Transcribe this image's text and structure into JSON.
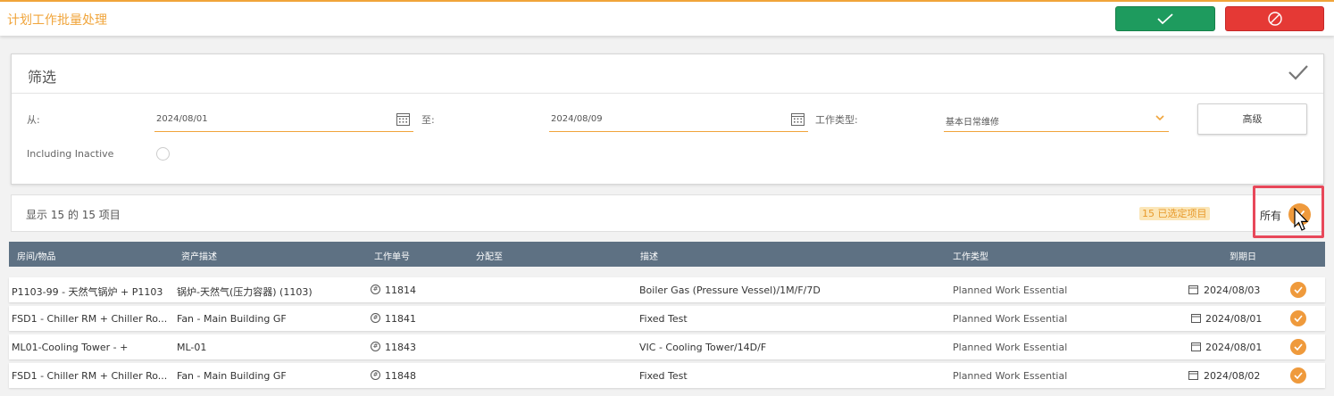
{
  "header": {
    "title": "计划工作批量处理"
  },
  "filter": {
    "title": "筛选",
    "from_label": "从:",
    "from_value": "2024/08/01",
    "to_label": "至:",
    "to_value": "2024/08/09",
    "worktype_label": "工作类型:",
    "worktype_value": "基本日常维修",
    "advanced_label": "高级",
    "inactive_label": "Including Inactive"
  },
  "summary": {
    "count_text": "显示 15 的 15 项目",
    "selected_badge": "15 已选定项目",
    "all_label": "所有"
  },
  "table": {
    "columns": [
      "房间/物品",
      "资产描述",
      "工作单号",
      "分配至",
      "描述",
      "工作类型",
      "到期日"
    ],
    "rows": [
      {
        "room": "P1103-99 - 天然气锅炉 + P1103",
        "asset": "锅炉-天然气(压力容器) (1103)",
        "order": "11814",
        "assigned": "",
        "desc": "Boiler Gas (Pressure Vessel)/1M/F/7D",
        "type": "Planned Work Essential",
        "due": "2024/08/03"
      },
      {
        "room": "FSD1 - Chiller RM + Chiller Ro...",
        "asset": "Fan - Main Building GF",
        "order": "11841",
        "assigned": "",
        "desc": "Fixed Test",
        "type": "Planned Work Essential",
        "due": "2024/08/01"
      },
      {
        "room": "ML01-Cooling Tower - +",
        "asset": "ML-01",
        "order": "11843",
        "assigned": "",
        "desc": "VIC - Cooling Tower/14D/F",
        "type": "Planned Work Essential",
        "due": "2024/08/01"
      },
      {
        "room": "FSD1 - Chiller RM + Chiller Ro...",
        "asset": "Fan - Main Building GF",
        "order": "11848",
        "assigned": "",
        "desc": "Fixed Test",
        "type": "Planned Work Essential",
        "due": "2024/08/02"
      }
    ]
  },
  "colors": {
    "accent": "#f0a43a",
    "confirm": "#1e9b5e",
    "cancel": "#e53935",
    "table_header": "#5e7183",
    "highlight": "#e8485a"
  }
}
